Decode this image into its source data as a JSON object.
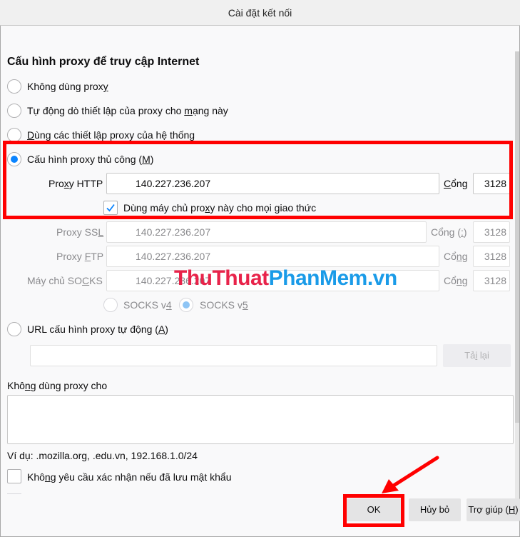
{
  "window": {
    "title": "Cài đặt kết nối"
  },
  "section_title": "Cấu hình proxy để truy cập Internet",
  "proxy_options": [
    {
      "label_pre": "Không dùng prox",
      "label_u": "y",
      "label_post": "",
      "checked": false
    },
    {
      "label_pre": "Tự động dò thiết lập của proxy cho ",
      "label_u": "m",
      "label_post": "ạng này",
      "checked": false
    },
    {
      "label_pre": "",
      "label_u": "D",
      "label_post": "ùng các thiết lập proxy của hệ thống",
      "checked": false
    },
    {
      "label_pre": "Cấu hình proxy thủ công (",
      "label_u": "M",
      "label_post": ")",
      "checked": true
    }
  ],
  "manual": {
    "http": {
      "label_pre": "Pro",
      "label_u": "x",
      "label_post": "y HTTP",
      "value": "140.227.236.207",
      "port_label_u": "C",
      "port_label_post": "ổng",
      "port": "3128"
    },
    "share_checkbox": {
      "label_pre": "Dùng máy chủ pro",
      "label_u": "x",
      "label_post": "y này cho mọi giao thức",
      "checked": true
    },
    "ssl": {
      "label_pre": "Proxy SS",
      "label_u": "L",
      "label_post": "",
      "value": "140.227.236.207",
      "port_label_pre": "Cổng (",
      "port_label_u": ":",
      "port_label_post": ")",
      "port": "3128"
    },
    "ftp": {
      "label_pre": "Proxy ",
      "label_u": "F",
      "label_post": "TP",
      "value": "140.227.236.207",
      "port_label_pre": "Cổ",
      "port_label_u": "n",
      "port_label_post": "g",
      "port": "3128"
    },
    "socks": {
      "label_pre": "Máy chủ SO",
      "label_u": "C",
      "label_post": "KS",
      "value": "140.227.236.207",
      "port_label_pre": "Cổ",
      "port_label_u": "n",
      "port_label_post": "g",
      "port": "3128"
    },
    "socks_v4": {
      "label_pre": "SOCKS v",
      "label_u": "4",
      "checked": false
    },
    "socks_v5": {
      "label_pre": "SOCKS v",
      "label_u": "5",
      "checked": true
    }
  },
  "auto_url": {
    "label_pre": "URL cấu hình proxy tự động (",
    "label_u": "A",
    "label_post": ")",
    "checked": false,
    "value": "",
    "reload_pre": "Tả",
    "reload_u": "i",
    "reload_post": " lại"
  },
  "no_proxy": {
    "label_pre": "Khô",
    "label_u": "n",
    "label_post": "g dùng proxy cho",
    "value": "",
    "example": "Ví dụ: .mozilla.org, .edu.vn, 192.168.1.0/24"
  },
  "no_prompt_checkbox": {
    "label_pre": "Khô",
    "label_u": "n",
    "label_post": "g yêu cầu xác nhận nếu đã lưu mật khẩu",
    "checked": false
  },
  "buttons": {
    "ok": "OK",
    "cancel": "Hủy bỏ",
    "help_pre": "Trợ giúp (",
    "help_u": "H",
    "help_post": ")"
  },
  "watermark": {
    "part1": "ThuThuat",
    "part2": "PhanMem",
    "part3": ".vn"
  },
  "annotation_colors": {
    "highlight": "#ff0000",
    "accent": "#0a84ff"
  }
}
